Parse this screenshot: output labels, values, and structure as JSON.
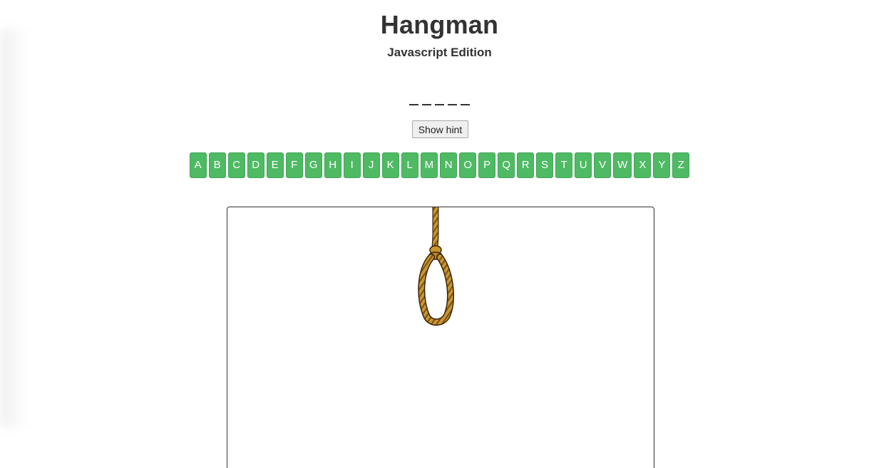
{
  "header": {
    "title": "Hangman",
    "subtitle": "Javascript Edition"
  },
  "word": {
    "blanks": [
      "",
      "",
      "",
      "",
      ""
    ]
  },
  "hint_button": {
    "label": "Show hint"
  },
  "letters": [
    "A",
    "B",
    "C",
    "D",
    "E",
    "F",
    "G",
    "H",
    "I",
    "J",
    "K",
    "L",
    "M",
    "N",
    "O",
    "P",
    "Q",
    "R",
    "S",
    "T",
    "U",
    "V",
    "W",
    "X",
    "Y",
    "Z"
  ],
  "colors": {
    "letter_bg": "#4fba64",
    "rope": "#c9962f",
    "rope_dark": "#5a3a10"
  },
  "stage": {
    "image": "noose-rope"
  }
}
